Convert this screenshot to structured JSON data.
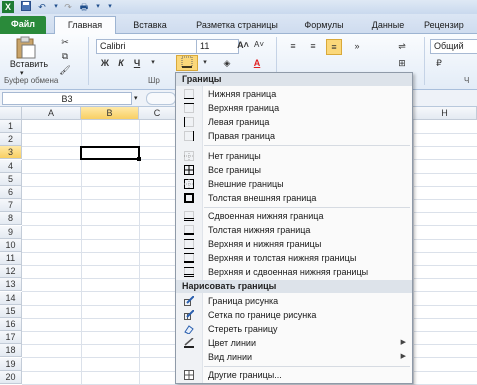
{
  "tabs": [
    {
      "label": "Файл"
    },
    {
      "label": "Главная"
    },
    {
      "label": "Вставка"
    },
    {
      "label": "Разметка страницы"
    },
    {
      "label": "Формулы"
    },
    {
      "label": "Данные"
    },
    {
      "label": "Рецензир"
    }
  ],
  "ribbon": {
    "paste_label": "Вставить",
    "clipboard_group": "Буфер обмена",
    "font_group": "Шр",
    "font_name": "Calibri",
    "font_size": "11",
    "bold": "Ж",
    "italic": "К",
    "underline": "Ч",
    "number_format": "Общий",
    "number_group_short": "Ч"
  },
  "formula_bar": {
    "cell_ref": "B3"
  },
  "grid": {
    "columns": [
      "A",
      "B",
      "C",
      "H"
    ],
    "rows": [
      "1",
      "2",
      "3",
      "4",
      "5",
      "6",
      "7",
      "8",
      "9",
      "10",
      "11",
      "12",
      "13",
      "14",
      "15",
      "16",
      "17",
      "18",
      "19",
      "20"
    ],
    "selected_cell": "B3"
  },
  "menu": {
    "header_borders": "Границы",
    "items_group1": [
      {
        "label": "Нижняя граница",
        "icon": "border-bottom-icon"
      },
      {
        "label": "Верхняя граница",
        "icon": "border-top-icon"
      },
      {
        "label": "Левая граница",
        "icon": "border-left-icon"
      },
      {
        "label": "Правая граница",
        "icon": "border-right-icon"
      }
    ],
    "items_group2": [
      {
        "label": "Нет границы",
        "icon": "no-border-icon"
      },
      {
        "label": "Все границы",
        "icon": "all-borders-icon"
      },
      {
        "label": "Внешние границы",
        "icon": "outside-borders-icon"
      },
      {
        "label": "Толстая внешняя граница",
        "icon": "thick-box-border-icon"
      }
    ],
    "items_group3": [
      {
        "label": "Сдвоенная нижняя граница",
        "icon": "double-bottom-border-icon"
      },
      {
        "label": "Толстая нижняя граница",
        "icon": "thick-bottom-border-icon"
      },
      {
        "label": "Верхняя и нижняя границы",
        "icon": "top-bottom-border-icon"
      },
      {
        "label": "Верхняя и толстая нижняя границы",
        "icon": "top-thick-bottom-border-icon"
      },
      {
        "label": "Верхняя и сдвоенная нижняя границы",
        "icon": "top-double-bottom-border-icon"
      }
    ],
    "header_draw": "Нарисовать границы",
    "items_draw": [
      {
        "label": "Граница рисунка",
        "icon": "draw-border-icon"
      },
      {
        "label": "Сетка по границе рисунка",
        "icon": "draw-border-grid-icon"
      },
      {
        "label": "Стереть границу",
        "icon": "eraser-icon"
      },
      {
        "label": "Цвет линии",
        "icon": "line-color-icon"
      },
      {
        "label": "Вид линии",
        "icon": "line-style-icon"
      }
    ],
    "more_borders": {
      "label": "Другие границы...",
      "icon": "more-borders-icon"
    }
  },
  "colors": {
    "file_tab": "#2a8a3a",
    "selected_header": "#f8cf63",
    "menu_header_bg": "#dde3ea",
    "line_color_swatch": "#222222",
    "font_color_swatch": "#e02020",
    "fill_color_swatch": "#ffe000"
  }
}
